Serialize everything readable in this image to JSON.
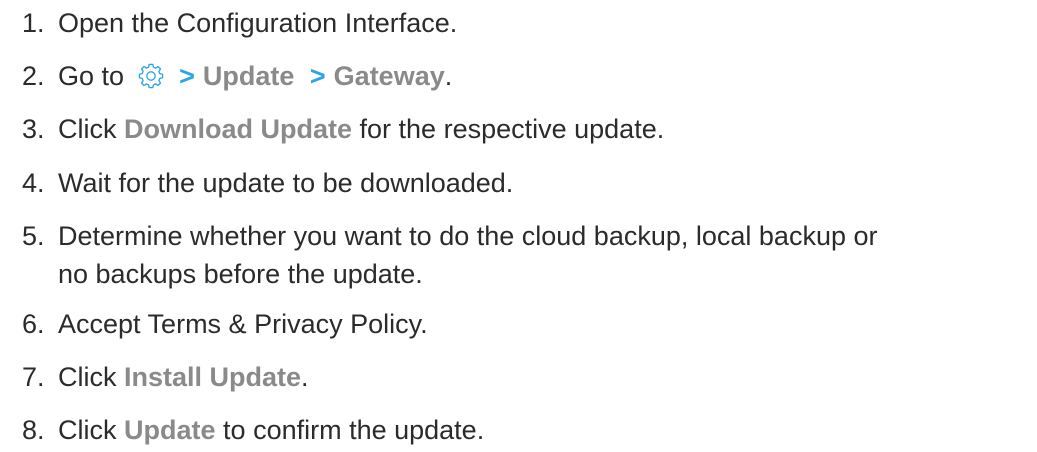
{
  "steps": [
    {
      "num": "1.",
      "text": "Open the Configuration Interface."
    },
    {
      "num": "2.",
      "prefix": "Go to",
      "icon": "gear-icon",
      "sep1": ">",
      "path1": "Update",
      "sep2": ">",
      "path2": "Gateway",
      "suffix": "."
    },
    {
      "num": "3.",
      "prefix": "Click",
      "ui": "Download Update",
      "suffix": "for the respective update."
    },
    {
      "num": "4.",
      "text": "Wait for the update to be downloaded."
    },
    {
      "num": "5.",
      "line1": "Determine whether you want to do the cloud backup, local backup or",
      "line2": "no backups before the update."
    },
    {
      "num": "6.",
      "text": "Accept Terms & Privacy Policy."
    },
    {
      "num": "7.",
      "prefix": "Click",
      "ui": "Install Update",
      "suffix": "."
    },
    {
      "num": "8.",
      "prefix": "Click",
      "ui": "Update",
      "suffix": "to confirm the update."
    }
  ],
  "colors": {
    "text": "#2b2b2b",
    "ui_label": "#8a8a8a",
    "separator": "#2aa5e6"
  }
}
